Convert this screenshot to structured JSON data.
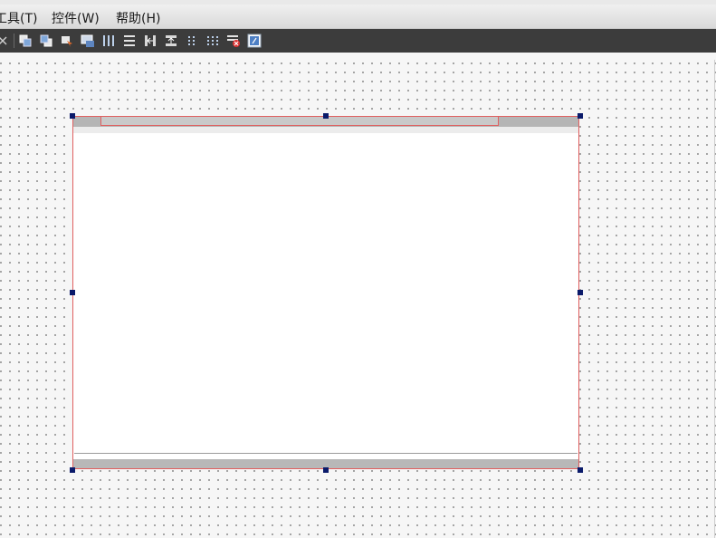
{
  "menubar": {
    "items": [
      {
        "label": "工具(T)"
      },
      {
        "label": "控件(W)"
      },
      {
        "label": "帮助(H)"
      }
    ]
  },
  "toolbar": {
    "icons": [
      "close-icon",
      "raise-icon",
      "lower-icon",
      "edit-tab-order-icon",
      "edit-buddies-icon",
      "layout-horizontal-icon",
      "layout-vertical-icon",
      "layout-horizontal-splitter-icon",
      "layout-vertical-splitter-icon",
      "layout-form-icon",
      "layout-grid-icon",
      "break-layout-icon",
      "adjust-size-icon"
    ]
  },
  "colors": {
    "toolbar_bg": "#3c3c3c",
    "selection_border": "#e06060",
    "handle": "#0a1a6a"
  }
}
